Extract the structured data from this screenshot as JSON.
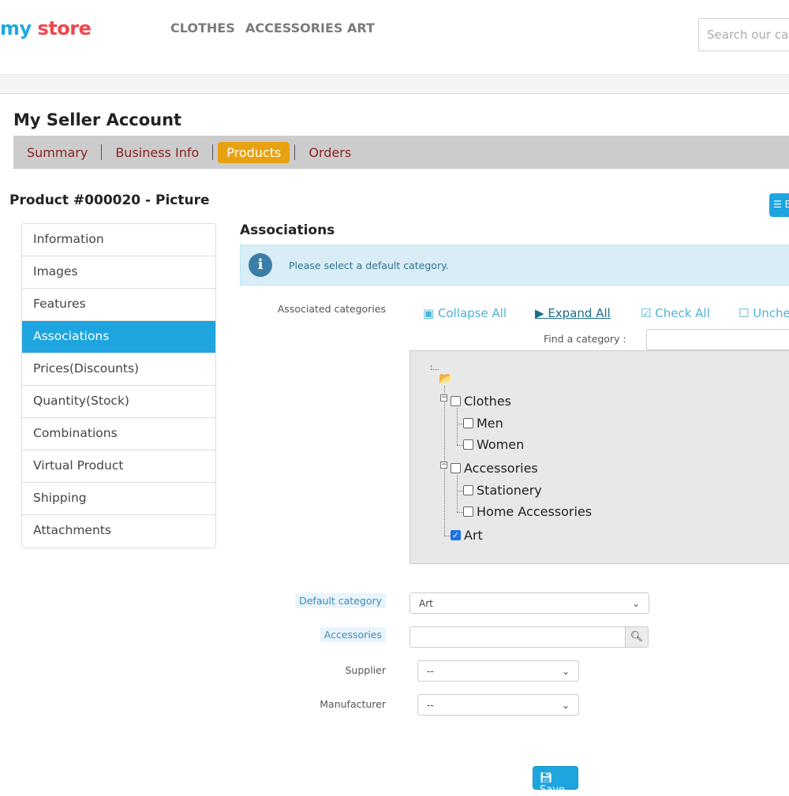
{
  "header": {
    "logo": {
      "part1": "my",
      "part2": " store"
    },
    "nav": [
      "CLOTHES",
      "ACCESSORIES",
      "ART"
    ],
    "search_placeholder": "Search our catalog"
  },
  "account": {
    "title": "My Seller Account",
    "tabs": [
      "Summary",
      "Business Info",
      "Products",
      "Orders"
    ],
    "active_tab": "Products"
  },
  "product": {
    "title": "Product #000020 - Picture",
    "top_button_icon": "list-icon",
    "top_button_label": "B"
  },
  "menu": {
    "items": [
      "Information",
      "Images",
      "Features",
      "Associations",
      "Prices(Discounts)",
      "Quantity(Stock)",
      "Combinations",
      "Virtual Product",
      "Shipping",
      "Attachments"
    ],
    "active": "Associations"
  },
  "associations": {
    "heading": "Associations",
    "alert": "Please select a default category.",
    "categories_label": "Associated categories",
    "links": {
      "collapse": "Collapse All",
      "expand": "Expand All",
      "check": "Check All",
      "uncheck": "Uncheck All"
    },
    "find_label": "Find a category :",
    "tree": [
      {
        "label": "Clothes",
        "checked": false
      },
      {
        "label": "Men",
        "checked": false
      },
      {
        "label": "Women",
        "checked": false
      },
      {
        "label": "Accessories",
        "checked": false
      },
      {
        "label": "Stationery",
        "checked": false
      },
      {
        "label": "Home Accessories",
        "checked": false
      },
      {
        "label": "Art",
        "checked": true
      }
    ],
    "default_category_label": "Default category",
    "default_category_value": "Art",
    "accessories_label": "Accessories",
    "accessories_value": "",
    "supplier_label": "Supplier",
    "supplier_value": "--",
    "manufacturer_label": "Manufacturer",
    "manufacturer_value": "--",
    "save": "Save"
  },
  "colors": {
    "accent": "#1ea5e0",
    "tab_active": "#e8a20f",
    "alert_bg": "#d9edf7"
  }
}
